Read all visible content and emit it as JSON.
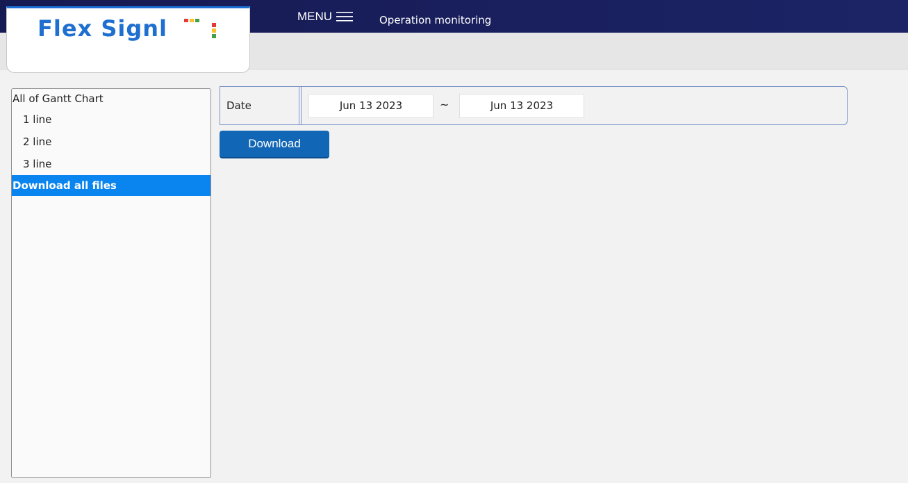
{
  "app": {
    "logo_text": "Flex Sign",
    "logo_last_letter": "l",
    "logo_signal_colors": [
      "#e53935",
      "#fbc02d",
      "#43a047"
    ]
  },
  "header": {
    "menu_label": "MENU",
    "page_title": "Operation monitoring"
  },
  "sidebar": {
    "items": [
      {
        "label": "All of Gantt Chart"
      },
      {
        "label": "1 line"
      },
      {
        "label": "2 line"
      },
      {
        "label": "3 line"
      },
      {
        "label": "Download all files"
      }
    ]
  },
  "filter": {
    "date_label": "Date",
    "date_from": "Jun 13 2023",
    "separator": "~",
    "date_to": "Jun 13 2023"
  },
  "actions": {
    "download_label": "Download"
  },
  "colors": {
    "header_bg": "#1a2060",
    "accent_blue": "#0a84ee",
    "button_blue": "#1266b6",
    "logo_blue": "#1f6fd0"
  }
}
